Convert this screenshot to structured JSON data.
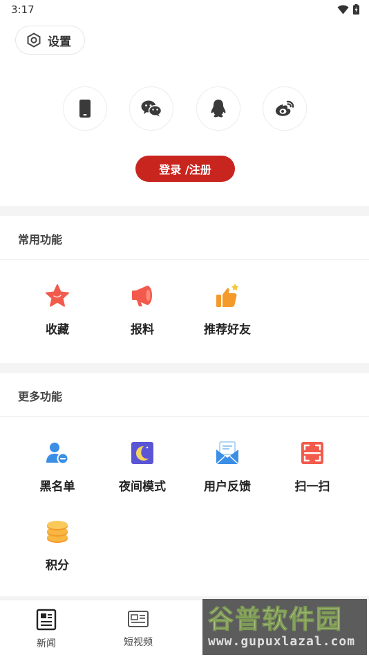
{
  "status_bar": {
    "time": "3:17"
  },
  "settings": {
    "label": "设置"
  },
  "login": {
    "methods": [
      "phone-icon",
      "wechat-icon",
      "qq-icon",
      "weibo-icon"
    ],
    "button_label": "登录 /注册",
    "button_color": "#c9251f"
  },
  "common": {
    "title": "常用功能",
    "items": [
      {
        "label": "收藏",
        "icon": "star-icon"
      },
      {
        "label": "报料",
        "icon": "megaphone-icon"
      },
      {
        "label": "推荐好友",
        "icon": "thumbs-up-icon"
      }
    ]
  },
  "more": {
    "title": "更多功能",
    "items": [
      {
        "label": "黑名单",
        "icon": "blocked-user-icon"
      },
      {
        "label": "夜间模式",
        "icon": "night-mode-icon"
      },
      {
        "label": "用户反馈",
        "icon": "envelope-icon"
      },
      {
        "label": "扫一扫",
        "icon": "scan-icon"
      },
      {
        "label": "积分",
        "icon": "coins-icon"
      }
    ]
  },
  "bottom_nav": {
    "items": [
      {
        "label": "新闻",
        "icon": "news-icon"
      },
      {
        "label": "短视频",
        "icon": "video-icon"
      }
    ]
  },
  "watermark": {
    "title": "谷普软件园",
    "url": "www.gupuxlazal.com"
  }
}
